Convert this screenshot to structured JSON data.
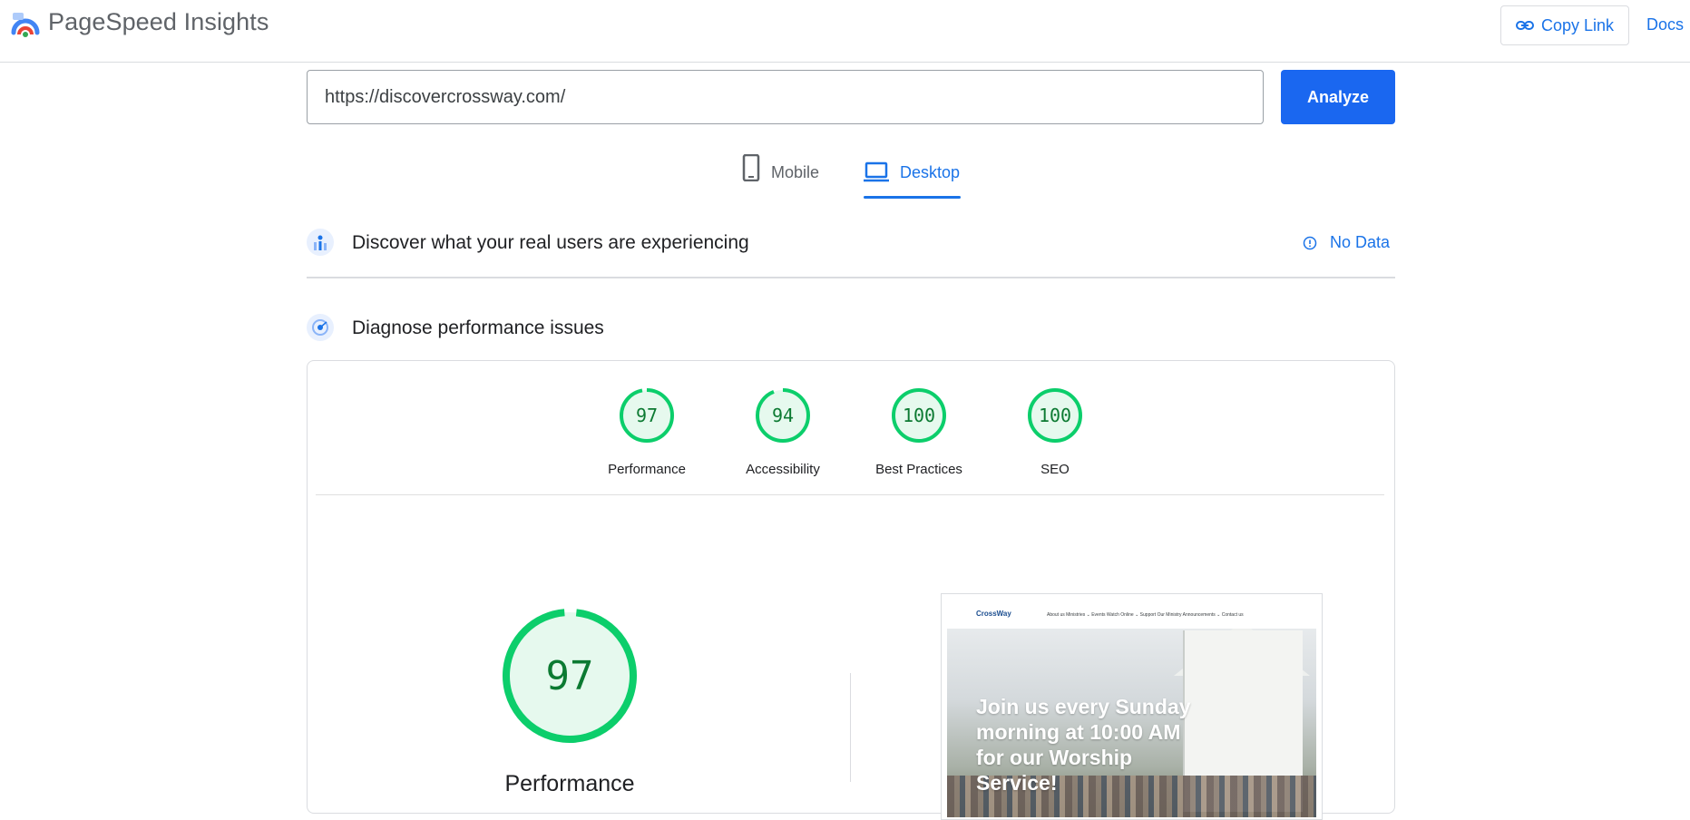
{
  "header": {
    "brand": "PageSpeed Insights",
    "copy_link": "Copy Link",
    "docs": "Docs"
  },
  "search": {
    "url_value": "https://discovercrossway.com/",
    "analyze_label": "Analyze"
  },
  "tabs": [
    {
      "label": "Mobile",
      "icon": "smartphone-icon",
      "active": false
    },
    {
      "label": "Desktop",
      "icon": "laptop-icon",
      "active": true
    }
  ],
  "field_data": {
    "title": "Discover what your real users are experiencing",
    "status": "No Data",
    "status_icon": "info-icon"
  },
  "lab_data": {
    "title": "Diagnose performance issues",
    "scores": [
      {
        "label": "Performance",
        "score": "97"
      },
      {
        "label": "Accessibility",
        "score": "94"
      },
      {
        "label": "Best Practices",
        "score": "100"
      },
      {
        "label": "SEO",
        "score": "100"
      }
    ],
    "main": {
      "label": "Performance",
      "score": "97"
    }
  },
  "screenshot": {
    "logo_text": "CrossWay",
    "menu": "About us   Ministries ⌄   Events   Watch Online ⌄   Support Our Ministry   Announcements ⌄   Contact us",
    "hero_text": "Join us every Sunday morning at 10:00 AM for our Worship Service!"
  },
  "colors": {
    "accent": "#1a73e8",
    "pass": "#0cce6b",
    "pass_bg": "#e6f9ee",
    "pass_text": "#0c7a32"
  }
}
